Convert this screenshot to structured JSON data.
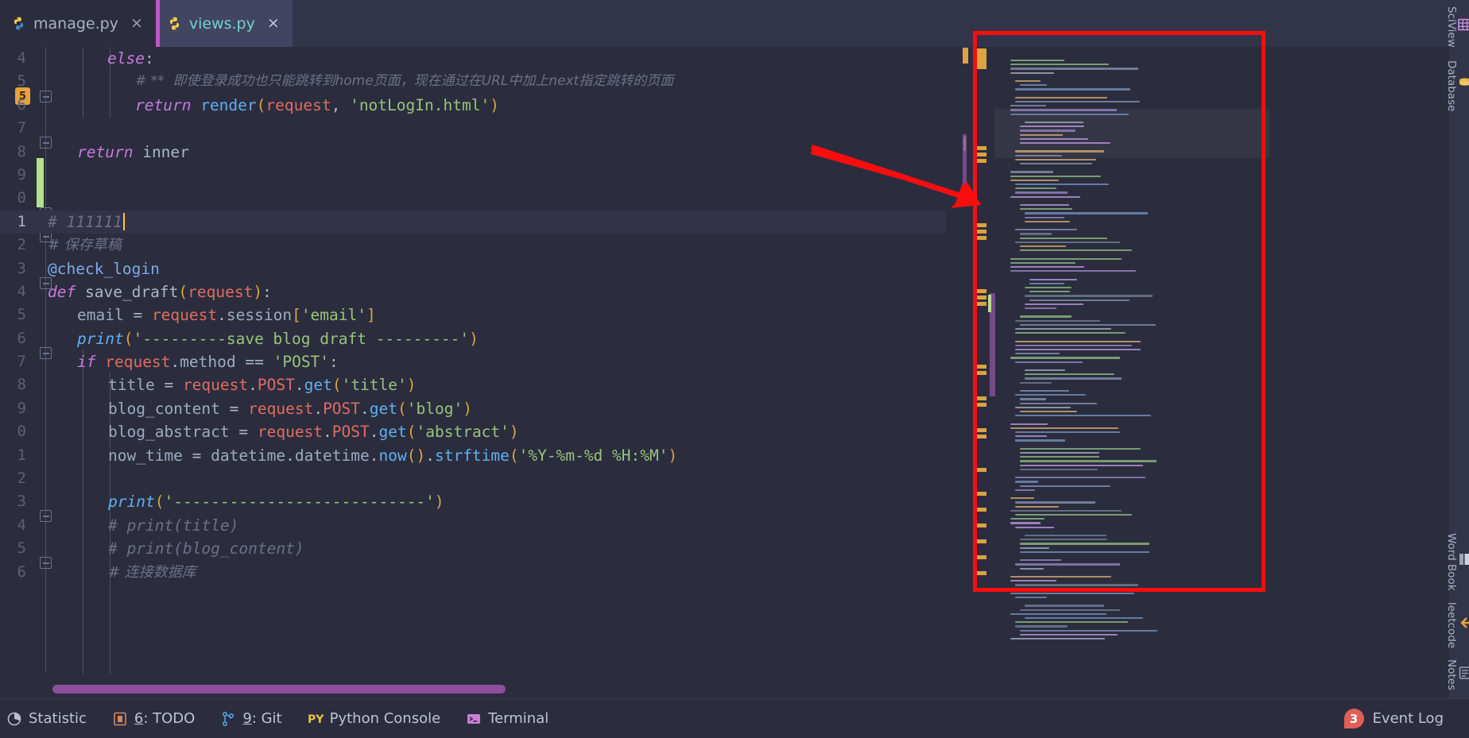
{
  "window": {
    "theme_bg": "#2b2d3e",
    "accent": "#c156c8",
    "annotation_color": "#fb0d0d"
  },
  "tabs": [
    {
      "label": "manage.py",
      "icon": "python-file-icon",
      "close": "×",
      "active": false
    },
    {
      "label": "views.py",
      "icon": "python-file-icon",
      "close": "×",
      "active": true
    }
  ],
  "editor": {
    "caret_line": 21,
    "lines": [
      {
        "num": "4",
        "indent": 0
      },
      {
        "num": "5",
        "indent": 0
      },
      {
        "num": "6",
        "indent": 0
      },
      {
        "num": "7",
        "indent": 0
      },
      {
        "num": "8",
        "indent": 0
      },
      {
        "num": "9",
        "indent": 0
      },
      {
        "num": "0",
        "indent": 0
      },
      {
        "num": "1",
        "indent": 0
      },
      {
        "num": "2",
        "indent": 0
      },
      {
        "num": "3",
        "indent": 0
      },
      {
        "num": "4",
        "indent": 0
      },
      {
        "num": "5",
        "indent": 0
      },
      {
        "num": "6",
        "indent": 0
      },
      {
        "num": "7",
        "indent": 0
      },
      {
        "num": "8",
        "indent": 0
      },
      {
        "num": "9",
        "indent": 0
      },
      {
        "num": "0",
        "indent": 0
      },
      {
        "num": "1",
        "indent": 0
      },
      {
        "num": "2",
        "indent": 0
      },
      {
        "num": "3",
        "indent": 0
      },
      {
        "num": "4",
        "indent": 0
      },
      {
        "num": "5",
        "indent": 0
      },
      {
        "num": "6",
        "indent": 0
      }
    ],
    "code_text": {
      "l4": "else:",
      "l5": "# **  即使登录成功也只能跳转到home页面，现在通过在URL中加上next指定跳转的页面",
      "l6": "return render(request, 'notLogIn.html')",
      "l8": "return inner",
      "l21": "# 111111",
      "l22": "# 保存草稿",
      "l23": "@check_login",
      "l24": "def save_draft(request):",
      "l25": "email = request.session['email']",
      "l26": "print('---------save blog draft ---------')",
      "l27": "if request.method == 'POST':",
      "l28": "title = request.POST.get('title')",
      "l29": "blog_content = request.POST.get('blog')",
      "l30": "blog_abstract = request.POST.get('abstract')",
      "l31": "now_time = datetime.datetime.now().strftime('%Y-%m-%d %H:%M')",
      "l33": "print('---------------------------')",
      "l34": "# print(title)",
      "l35": "# print(blog_content)",
      "l36": "# 连接数据库"
    },
    "tokens": {
      "kw_else": "else",
      "kw_return": "return",
      "kw_def": "def",
      "kw_if": "if",
      "fn_render": "render",
      "fn_print": "print",
      "fn_get": "get",
      "fn_now": "now",
      "fn_strftime": "strftime",
      "fn_save_draft": "save_draft",
      "decorator": "@check_login",
      "id_request": "request",
      "id_inner": "inner",
      "id_email": "email",
      "id_session": "session",
      "id_method": "method",
      "id_title": "title",
      "id_blog_content": "blog_content",
      "id_blog_abstract": "blog_abstract",
      "id_now_time": "now_time",
      "id_datetime": "datetime",
      "id_POST": "POST",
      "str_notlogin": "'notLogIn.html'",
      "str_email": "'email'",
      "str_savedraft": "'---------save blog draft ---------'",
      "str_post": "'POST'",
      "str_title": "'title'",
      "str_blog": "'blog'",
      "str_abstract": "'abstract'",
      "str_fmt": "'%Y-%m-%d %H:%M'",
      "str_dashes": "'---------------------------'"
    },
    "gutter": {
      "html5_badge": "5"
    }
  },
  "minimap": {
    "name": "code-minimap",
    "highlight_color": "#d9a441",
    "change_color": "#8b4f9c"
  },
  "right_sidebar": [
    {
      "label": "SciView",
      "icon": "sciview-grid-icon"
    },
    {
      "label": "Database",
      "icon": "database-icon"
    },
    {
      "label": "Word Book",
      "icon": "word-book-icon"
    },
    {
      "label": "leetcode",
      "icon": "leetcode-icon"
    },
    {
      "label": "Notes",
      "icon": "notes-icon"
    }
  ],
  "status_bar": {
    "items": [
      {
        "label": "Statistic",
        "icon": "statistic-icon",
        "mnemonic": ""
      },
      {
        "label": ": TODO",
        "icon": "todo-icon",
        "mnemonic": "6"
      },
      {
        "label": ": Git",
        "icon": "git-branch-icon",
        "mnemonic": "9"
      },
      {
        "label": "Python Console",
        "icon": "python-console-icon",
        "mnemonic": ""
      },
      {
        "label": "Terminal",
        "icon": "terminal-icon",
        "mnemonic": ""
      }
    ],
    "event_log": {
      "label": "Event Log",
      "count": "3",
      "badge_color": "#e05f57"
    }
  }
}
